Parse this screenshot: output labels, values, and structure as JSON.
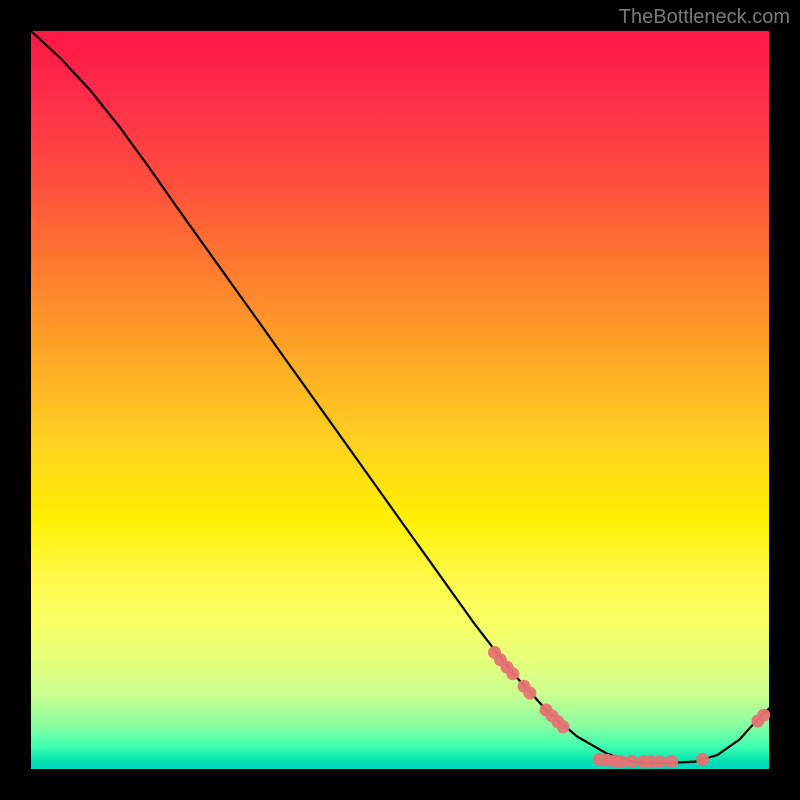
{
  "watermark": "TheBottleneck.com",
  "chart_data": {
    "type": "line",
    "title": "",
    "xlabel": "",
    "ylabel": "",
    "xlim": [
      0,
      100
    ],
    "ylim": [
      0,
      100
    ],
    "curve": [
      {
        "x": 0.0,
        "y": 100.0
      },
      {
        "x": 4.0,
        "y": 96.3
      },
      {
        "x": 8.0,
        "y": 92.0
      },
      {
        "x": 12.0,
        "y": 87.0
      },
      {
        "x": 16.0,
        "y": 81.5
      },
      {
        "x": 20.0,
        "y": 75.8
      },
      {
        "x": 25.0,
        "y": 68.8
      },
      {
        "x": 30.0,
        "y": 61.8
      },
      {
        "x": 35.0,
        "y": 54.8
      },
      {
        "x": 40.0,
        "y": 47.8
      },
      {
        "x": 45.0,
        "y": 40.8
      },
      {
        "x": 50.0,
        "y": 33.8
      },
      {
        "x": 55.0,
        "y": 26.8
      },
      {
        "x": 60.0,
        "y": 19.8
      },
      {
        "x": 65.0,
        "y": 13.3
      },
      {
        "x": 70.0,
        "y": 7.8
      },
      {
        "x": 74.0,
        "y": 4.4
      },
      {
        "x": 78.0,
        "y": 2.1
      },
      {
        "x": 82.0,
        "y": 0.9
      },
      {
        "x": 86.0,
        "y": 0.8
      },
      {
        "x": 90.0,
        "y": 1.0
      },
      {
        "x": 93.0,
        "y": 1.9
      },
      {
        "x": 96.0,
        "y": 4.0
      },
      {
        "x": 98.0,
        "y": 6.2
      },
      {
        "x": 100.0,
        "y": 8.2
      }
    ],
    "dot_cluster_1": [
      {
        "x": 62.8,
        "y": 15.8
      },
      {
        "x": 63.6,
        "y": 14.8
      },
      {
        "x": 64.5,
        "y": 13.8
      },
      {
        "x": 65.3,
        "y": 12.9
      },
      {
        "x": 66.8,
        "y": 11.2
      },
      {
        "x": 67.6,
        "y": 10.3
      },
      {
        "x": 69.8,
        "y": 8.0
      },
      {
        "x": 70.6,
        "y": 7.2
      },
      {
        "x": 71.4,
        "y": 6.4
      },
      {
        "x": 72.1,
        "y": 5.7
      }
    ],
    "dot_cluster_2": [
      {
        "x": 77.0,
        "y": 1.3
      },
      {
        "x": 78.0,
        "y": 1.2
      },
      {
        "x": 79.0,
        "y": 1.1
      },
      {
        "x": 80.0,
        "y": 1.0
      },
      {
        "x": 81.4,
        "y": 1.0
      },
      {
        "x": 83.0,
        "y": 1.0
      },
      {
        "x": 84.0,
        "y": 1.0
      },
      {
        "x": 85.2,
        "y": 1.0
      },
      {
        "x": 86.8,
        "y": 1.0
      },
      {
        "x": 91.0,
        "y": 1.3
      }
    ],
    "dot_cluster_3": [
      {
        "x": 98.5,
        "y": 6.5
      },
      {
        "x": 99.3,
        "y": 7.3
      }
    ]
  }
}
